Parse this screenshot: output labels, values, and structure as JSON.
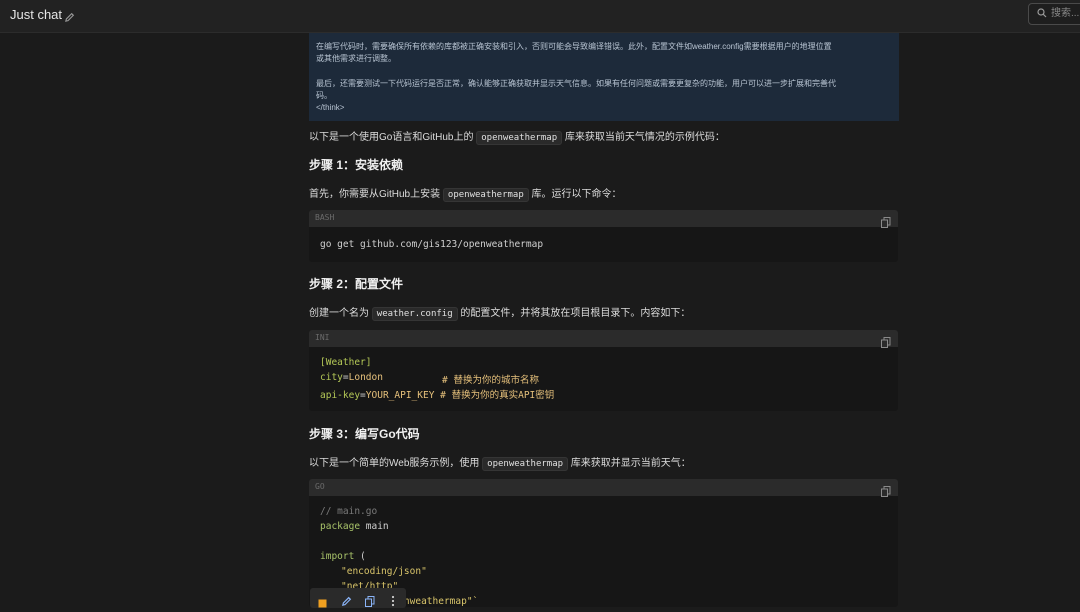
{
  "header": {
    "title": "Just chat",
    "search_placeholder": "搜索..."
  },
  "think": {
    "line1": "在编写代码时，需要确保所有依赖的库都被正确安装和引入，否则可能会导致编译错误。此外，配置文件如weather.config需要根据用户的地理位置",
    "line2": "或其他需求进行调整。",
    "line3": "最后，还需要测试一下代码运行是否正常，确认能够正确获取并显示天气信息。如果有任何问题或需要更复杂的功能，用户可以进一步扩展和完善代",
    "line4": "码。",
    "line5": "</think>"
  },
  "intro": {
    "before": "以下是一个使用Go语言和GitHub上的 ",
    "code": "openweathermap",
    "after": " 库来获取当前天气情况的示例代码："
  },
  "step1": {
    "heading": "步骤 1：安装依赖",
    "text_before": "首先，你需要从GitHub上安装 ",
    "code": "openweathermap",
    "text_after": " 库。运行以下命令：",
    "lang": "BASH",
    "cmd": "go get github.com/gis123/openweathermap"
  },
  "step2": {
    "heading": "步骤 2：配置文件",
    "text_before": "创建一个名为 ",
    "code": "weather.config",
    "text_after": " 的配置文件，并将其放在项目根目录下。内容如下：",
    "lang": "INI",
    "section": "[Weather]",
    "line_city_key": "city",
    "line_city_val": "London",
    "line_city_comment": "# 替换为你的城市名称",
    "line_api_key": "api-key",
    "line_api_val": "YOUR_API_KEY",
    "line_api_comment": "# 替换为你的真实API密钥"
  },
  "step3": {
    "heading": "步骤 3：编写Go代码",
    "text_before": "以下是一个简单的Web服务示例，使用 ",
    "code": "openweathermap",
    "text_after": " 库来获取并显示当前天气：",
    "lang": "GO",
    "line1": "// main.go",
    "line2_kw": "package",
    "line2_rest": " main",
    "line4_kw": "import",
    "line4_rest": " (",
    "line5": "\"encoding/json\"",
    "line6": "\"net/http\"",
    "line7": "\"gis123/openweathermap\"`"
  },
  "colors": {
    "background": "#1b1b1b",
    "think_bg": "#1d2a3a",
    "accent_orange": "#f0a020",
    "code_green": "#b5c957",
    "code_yellow": "#e5c07b"
  },
  "icons": [
    "pencil-icon",
    "search-icon",
    "copy-icon",
    "stop-icon",
    "edit-icon",
    "duplicate-icon",
    "more-icon"
  ]
}
